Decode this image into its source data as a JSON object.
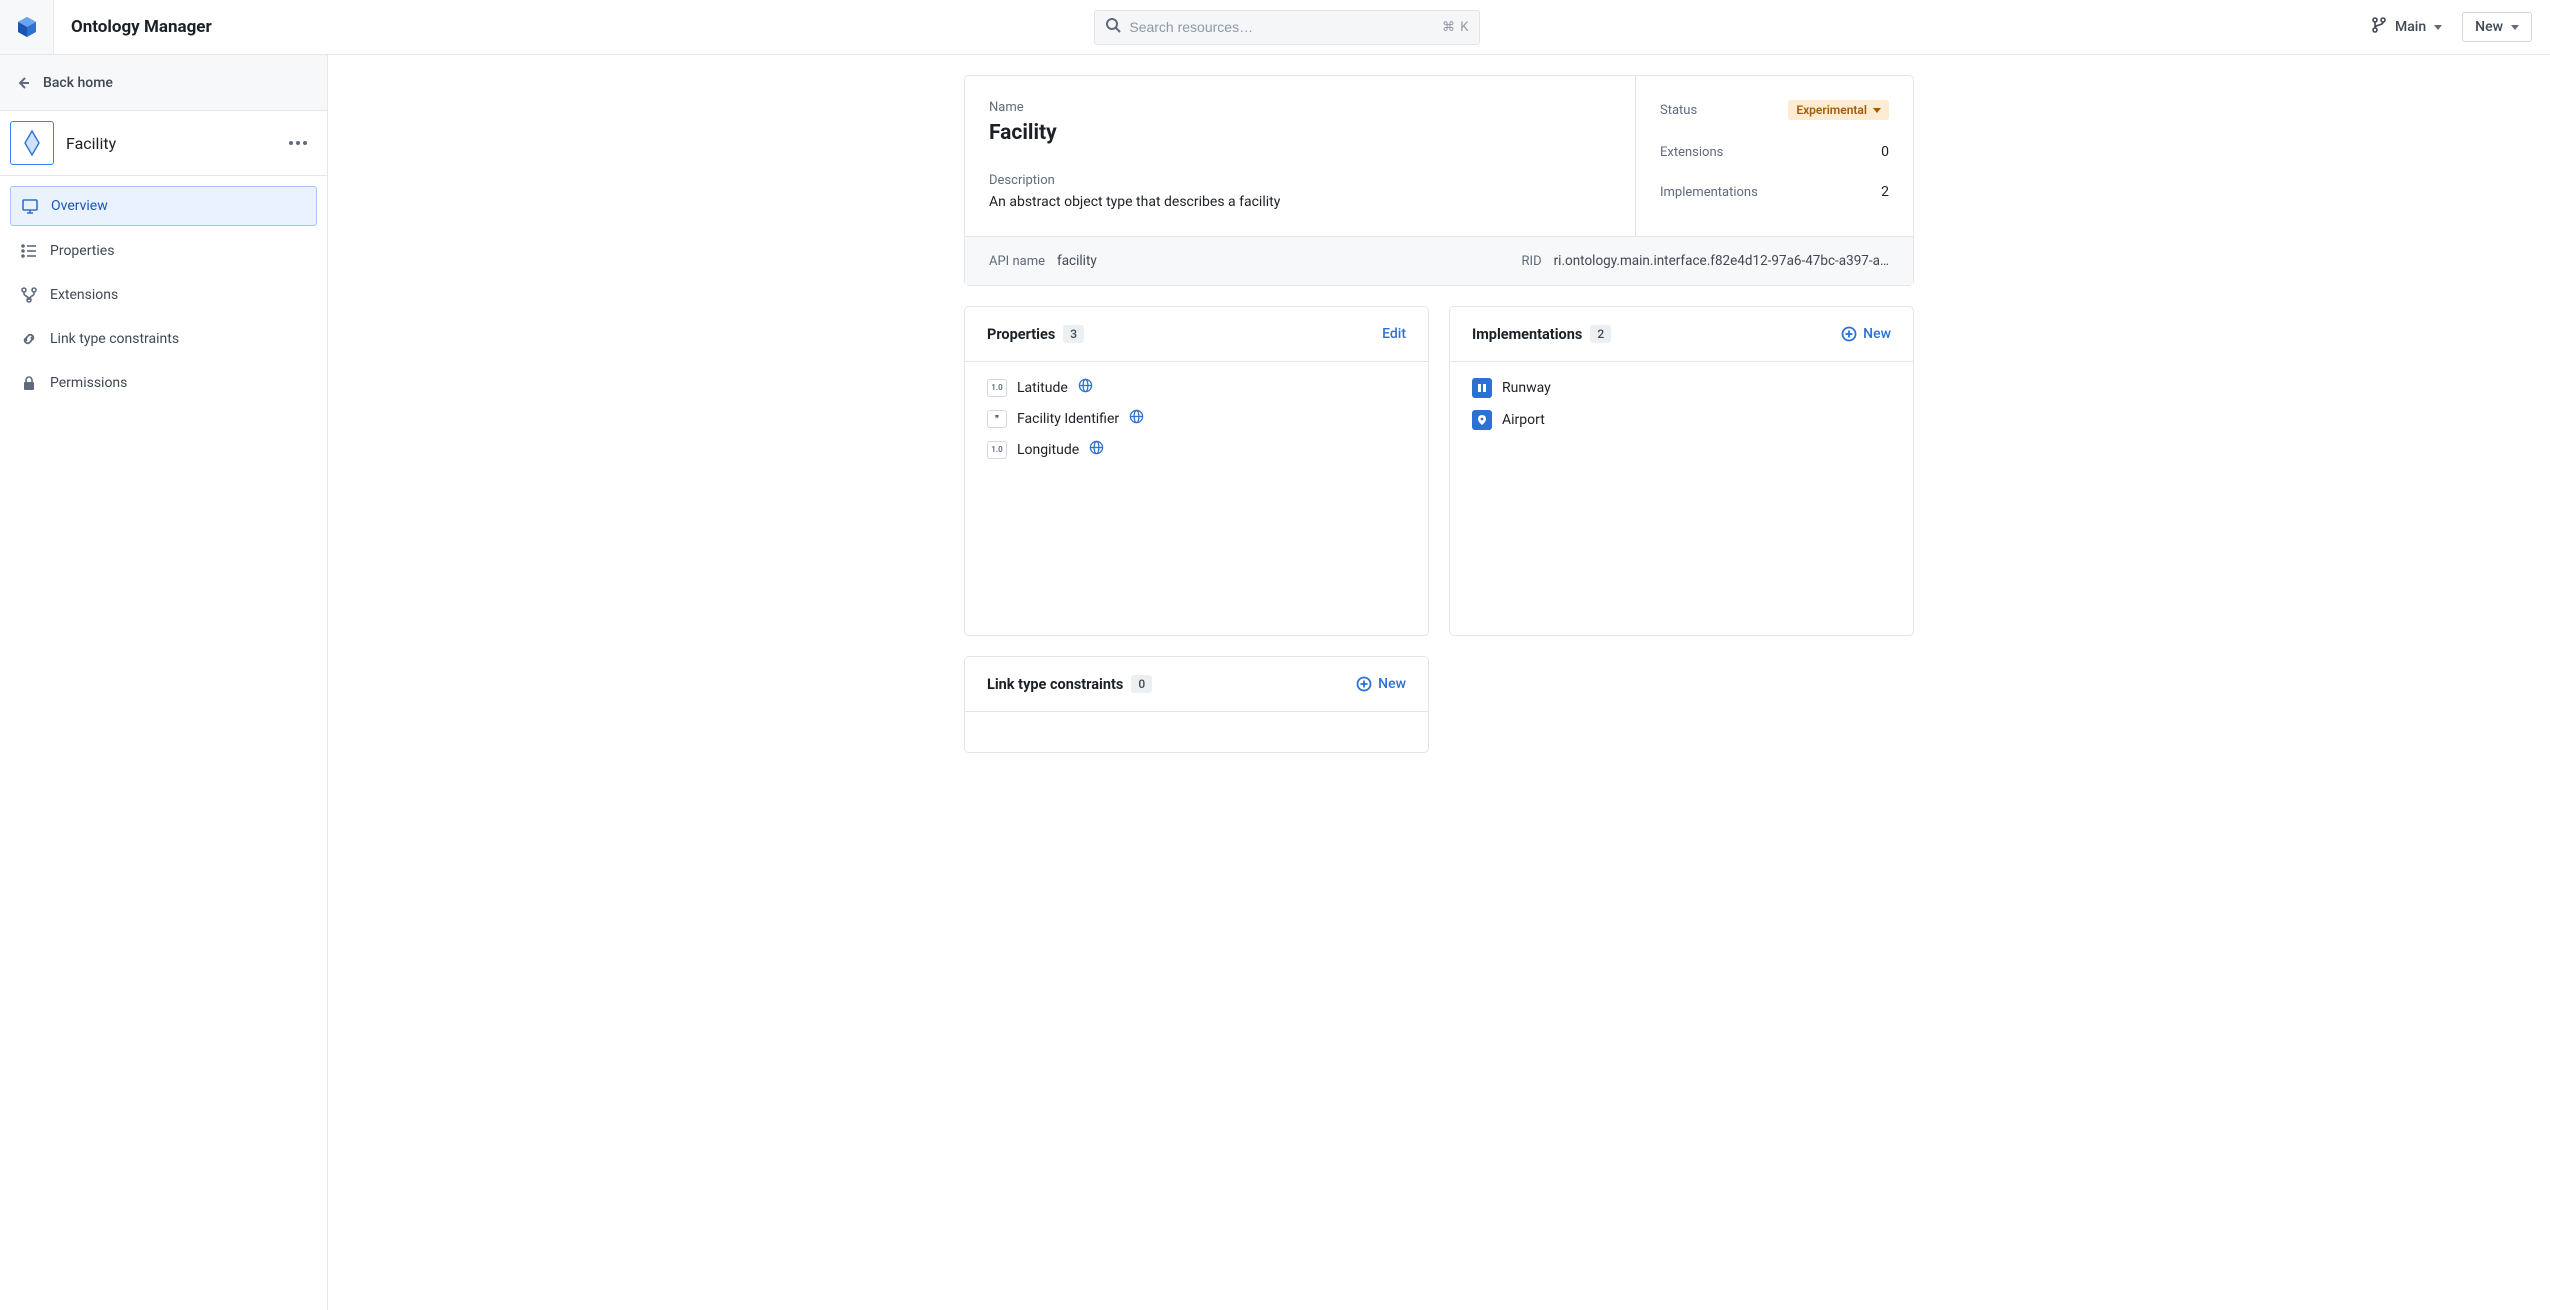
{
  "app": {
    "title": "Ontology Manager"
  },
  "search": {
    "placeholder": "Search resources…",
    "shortcut": "⌘ K"
  },
  "branch": {
    "label": "Main"
  },
  "topbar": {
    "new_label": "New"
  },
  "sidebar": {
    "back_label": "Back home",
    "entity_name": "Facility",
    "nav": [
      {
        "label": "Overview"
      },
      {
        "label": "Properties"
      },
      {
        "label": "Extensions"
      },
      {
        "label": "Link type constraints"
      },
      {
        "label": "Permissions"
      }
    ]
  },
  "detail": {
    "name_label": "Name",
    "name": "Facility",
    "description_label": "Description",
    "description": "An abstract object type that describes a facility",
    "status_label": "Status",
    "status_value": "Experimental",
    "extensions_label": "Extensions",
    "extensions_count": "0",
    "implementations_label": "Implementations",
    "implementations_count": "2",
    "api_name_label": "API name",
    "api_name_value": "facility",
    "rid_label": "RID",
    "rid_value": "ri.ontology.main.interface.f82e4d12-97a6-47bc-a397-a…"
  },
  "properties_card": {
    "title": "Properties",
    "count": "3",
    "action": "Edit",
    "items": [
      {
        "badge": "1.0",
        "name": "Latitude"
      },
      {
        "badge": "❞",
        "name": "Facility Identifier"
      },
      {
        "badge": "1.0",
        "name": "Longitude"
      }
    ]
  },
  "implementations_card": {
    "title": "Implementations",
    "count": "2",
    "action": "New",
    "items": [
      {
        "name": "Runway"
      },
      {
        "name": "Airport"
      }
    ]
  },
  "ltc_card": {
    "title": "Link type constraints",
    "count": "0",
    "action": "New"
  }
}
